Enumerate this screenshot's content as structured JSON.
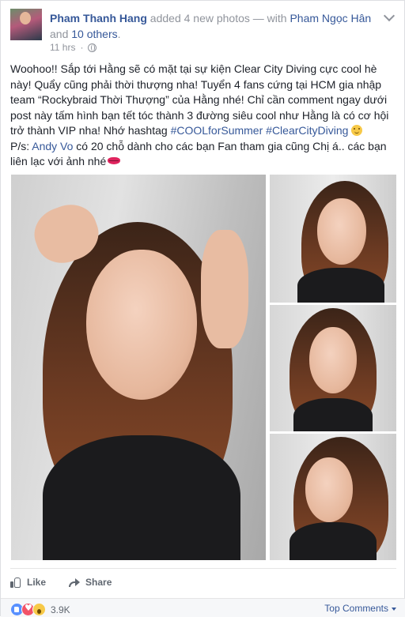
{
  "header": {
    "author": "Pham Thanh Hang",
    "action": " added 4 new photos — with ",
    "tagged": "Pham Ngọc Hân",
    "and": " and ",
    "others": "10 others",
    "period": ".",
    "time": "11 hrs",
    "separator": "·"
  },
  "post": {
    "text_1": "Woohoo!! Sắp tới Hằng sẽ có mặt tại sự kiện Clear City Diving cực cool hè này! Quẩy cũng phải thời thượng nha! Tuyển 4 fans cứng tại HCM gia nhập team “Rockybraid Thời Thượng” của Hằng nhé! Chỉ cần comment ngay dưới post này tấm hình bạn tết tóc thành 3 đường siêu cool như Hằng là có cơ hội trở thành VIP nha! Nhớ hashtag ",
    "hashtag_1": "#COOLforSummer",
    "space": " ",
    "hashtag_2": "#ClearCityDiving",
    "ps_label": "P/s: ",
    "mention": "Andy Vo",
    "text_2": " có 20 chỗ dành cho các bạn Fan tham gia cũng Chị á.. các bạn liên lạc với ảnh nhé"
  },
  "actions": {
    "like": "Like",
    "share": "Share"
  },
  "footer": {
    "reaction_count": "3.9K",
    "top_comments": "Top Comments"
  },
  "colors": {
    "link": "#365899",
    "muted": "#90949c",
    "text": "#1d2129"
  },
  "icons": [
    "globe-icon",
    "chevron-down-icon",
    "smile-emoji-icon",
    "kiss-lips-icon",
    "like-icon",
    "share-icon",
    "like-reaction-icon",
    "love-reaction-icon",
    "wow-reaction-icon",
    "caret-down-icon"
  ]
}
